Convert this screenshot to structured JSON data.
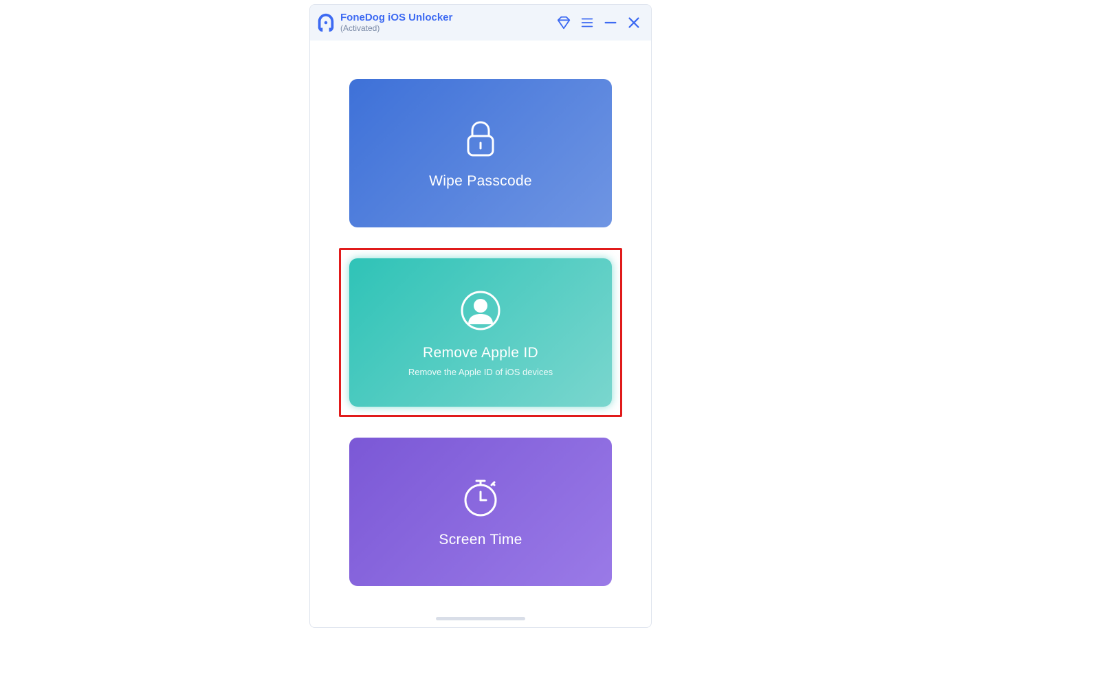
{
  "header": {
    "title": "FoneDog iOS Unlocker",
    "status": "(Activated)"
  },
  "cards": {
    "wipe": {
      "title": "Wipe Passcode"
    },
    "apple": {
      "title": "Remove Apple ID",
      "subtitle": "Remove the Apple ID of iOS devices"
    },
    "screen": {
      "title": "Screen Time"
    }
  }
}
